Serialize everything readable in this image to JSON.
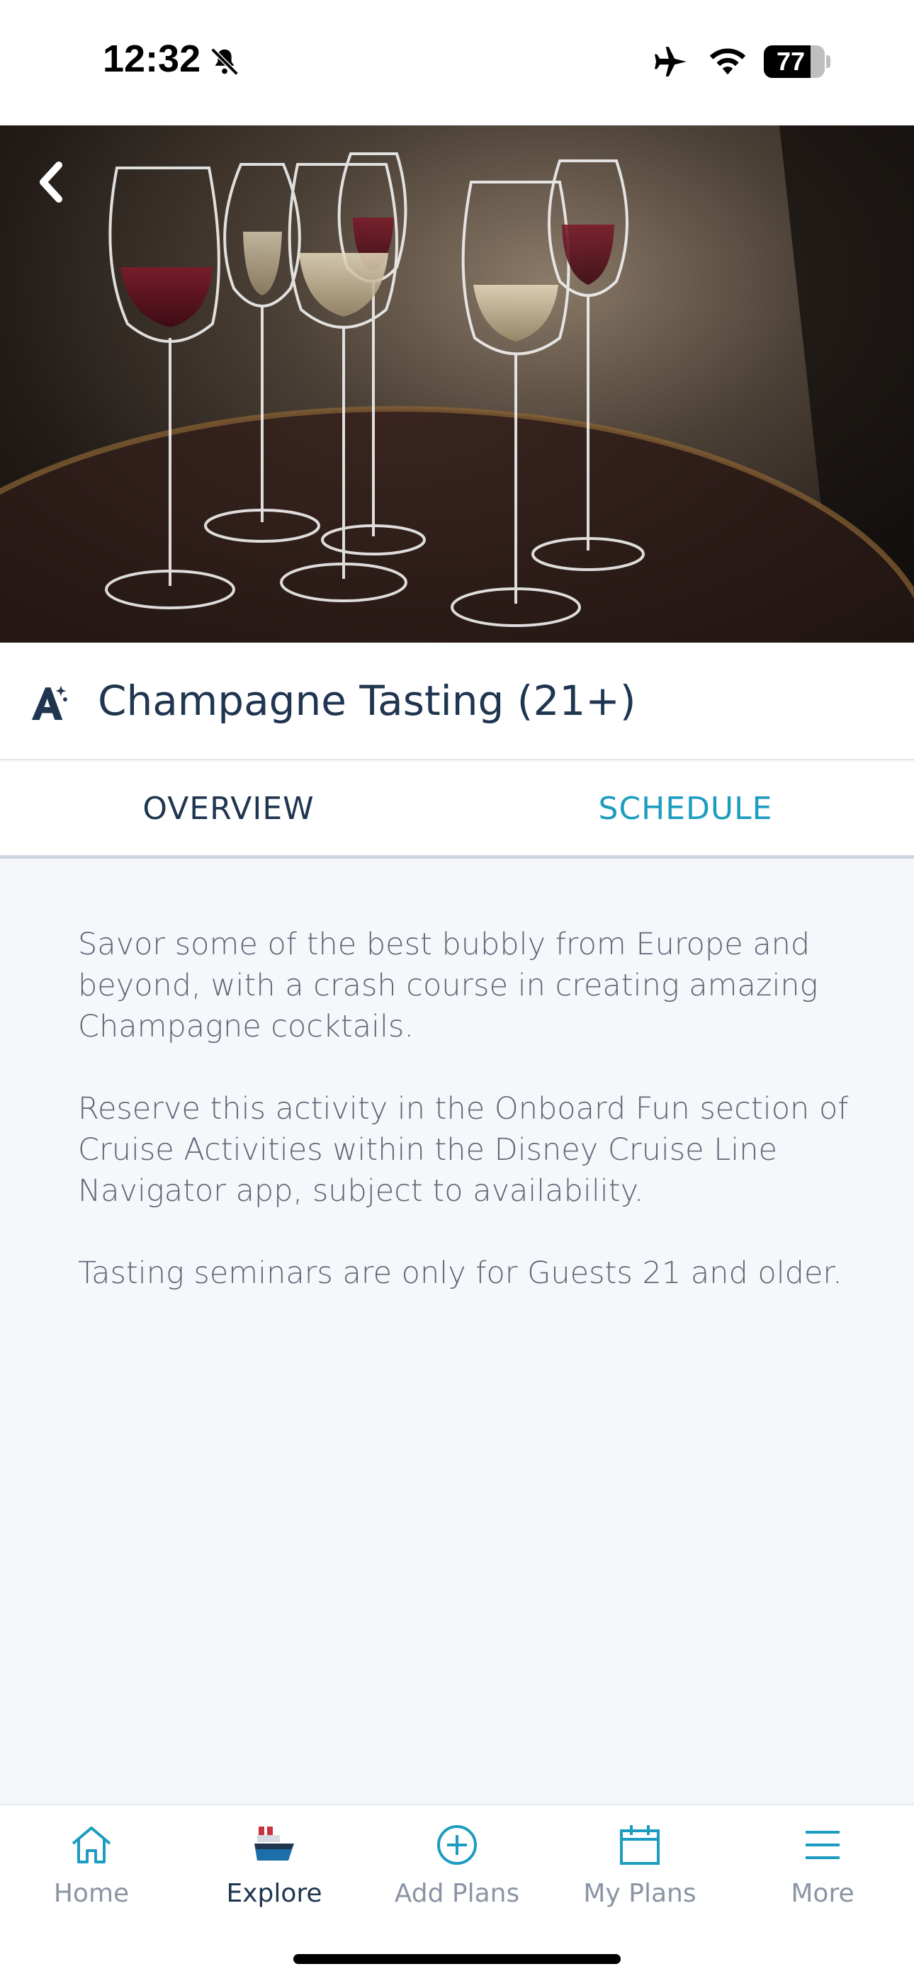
{
  "status_bar": {
    "time": "12:32",
    "battery": "77",
    "battery_level": 0.77,
    "icons": [
      "bell-muted-icon",
      "airplane-icon",
      "wifi-icon",
      "battery-icon"
    ]
  },
  "header": {
    "back_icon": "chevron-left-icon",
    "title": "Champagne Tasting (21+)",
    "title_icon": "activity-sparkle-icon"
  },
  "tabs": [
    {
      "label": "OVERVIEW",
      "active": true
    },
    {
      "label": "SCHEDULE",
      "active": false
    }
  ],
  "overview": {
    "paragraphs": [
      "Savor some of the best bubbly from Europe and beyond, with a crash course in creating amazing Champagne cocktails.",
      "Reserve this activity in the Onboard Fun section of Cruise Activities within the Disney Cruise Line Navigator app, subject to availability.",
      "Tasting seminars are only for Guests 21 and older."
    ]
  },
  "bottom_nav": [
    {
      "label": "Home",
      "icon": "home-icon",
      "active": false
    },
    {
      "label": "Explore",
      "icon": "ship-icon",
      "active": true
    },
    {
      "label": "Add Plans",
      "icon": "plus-circle-icon",
      "active": false
    },
    {
      "label": "My Plans",
      "icon": "calendar-icon",
      "active": false
    },
    {
      "label": "More",
      "icon": "menu-icon",
      "active": false
    }
  ],
  "colors": {
    "navy": "#1f3550",
    "accent": "#1c9cc0",
    "muted": "#8a94a3",
    "body_text": "#5d6775",
    "background": "#f5f7fb"
  }
}
